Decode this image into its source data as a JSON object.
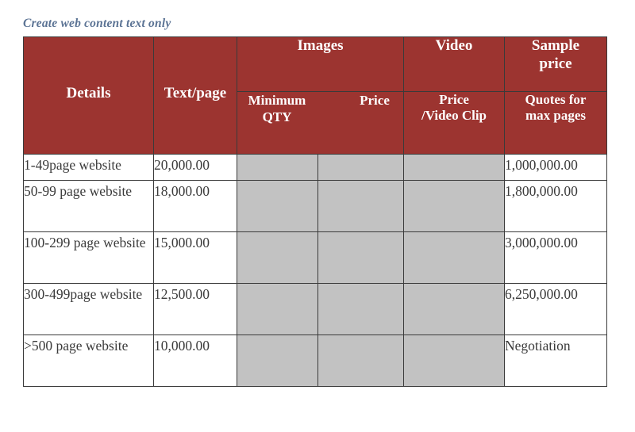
{
  "document": {
    "title": "Create web content text only"
  },
  "table": {
    "header": {
      "group_row": [
        {
          "label": "",
          "key": "details-blank"
        },
        {
          "label": "",
          "key": "textpage-blank"
        },
        {
          "label": "Images",
          "key": "images"
        },
        {
          "label": "Video",
          "key": "video"
        },
        {
          "label": "Sample price",
          "key": "sample-price"
        }
      ],
      "sub_row": [
        {
          "label": "Details",
          "key": "details"
        },
        {
          "label": "Text/page",
          "key": "text-per-page"
        },
        {
          "label": "Minimum QTY",
          "key": "minimum-qty"
        },
        {
          "label": "Price",
          "key": "images-price"
        },
        {
          "label": "Price /Video Clip",
          "key": "price-per-video-clip"
        },
        {
          "label": "Quotes for max pages",
          "key": "quotes-for-max-pages"
        }
      ],
      "sub_row_parts": {
        "minimum_qty_line1": "Minimum",
        "minimum_qty_line2": "QTY",
        "images_price": "Price",
        "video_price_line1": "Price",
        "video_price_line2": "/Video Clip",
        "sample_line1": "Sample",
        "sample_line2": "price",
        "quotes_line1": "Quotes for",
        "quotes_line2": "max pages"
      }
    },
    "rows": [
      {
        "details": "1-49page website",
        "text_per_page": "20,000.00",
        "images_min_qty": "",
        "images_price": "",
        "price_per_video_clip": "",
        "quotes_for_max_pages": "1,000,000.00"
      },
      {
        "details": "50-99 page website",
        "text_per_page": "18,000.00",
        "images_min_qty": "",
        "images_price": "",
        "price_per_video_clip": "",
        "quotes_for_max_pages": "1,800,000.00"
      },
      {
        "details": "100-299 page website",
        "text_per_page": "15,000.00",
        "images_min_qty": "",
        "images_price": "",
        "price_per_video_clip": "",
        "quotes_for_max_pages": "3,000,000.00"
      },
      {
        "details": "300-499page website",
        "text_per_page": "12,500.00",
        "images_min_qty": "",
        "images_price": "",
        "price_per_video_clip": "",
        "quotes_for_max_pages": "6,250,000.00"
      },
      {
        "details": ">500 page website",
        "text_per_page": "10,000.00",
        "images_min_qty": "",
        "images_price": "",
        "price_per_video_clip": "",
        "quotes_for_max_pages": "Negotiation"
      }
    ]
  },
  "colors": {
    "header_background": "#9c3430",
    "header_text": "#ffffff",
    "title_text": "#5b7394",
    "shaded_cell": "#c2c2c2",
    "border": "#3a3a3a",
    "body_text": "#3b3b3b"
  }
}
